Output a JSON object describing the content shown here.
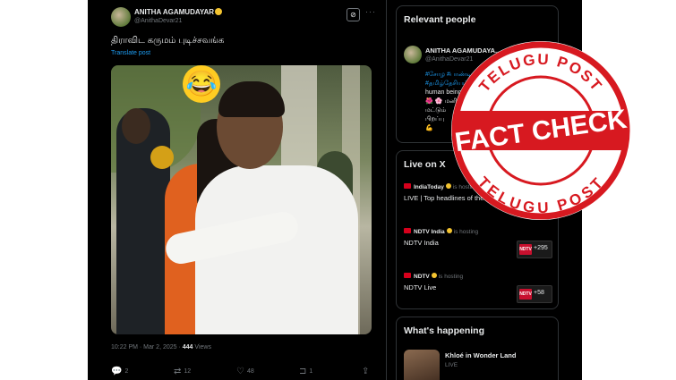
{
  "post": {
    "author_name": "ANITHA AGAMUDAYAR",
    "author_handle": "@AnithaDevar21",
    "text": "திராவிட கருமம் புடிச்சவங்க",
    "translate_label": "Translate post",
    "emoji": "😂",
    "timestamp": "10:22 PM · Mar 2, 2025 · ",
    "views_count": "444",
    "views_label": " Views",
    "actions": [
      {
        "icon": "reply-icon",
        "glyph": "💬",
        "count": "2"
      },
      {
        "icon": "repost-icon",
        "glyph": "⇄",
        "count": "12"
      },
      {
        "icon": "like-icon",
        "glyph": "♡",
        "count": "48"
      },
      {
        "icon": "bookmark-icon",
        "glyph": "⊐",
        "count": "1"
      },
      {
        "icon": "share-icon",
        "glyph": "⇪",
        "count": ""
      }
    ],
    "grok_glyph": "⊘",
    "more_glyph": "···"
  },
  "relevant_people": {
    "heading": "Relevant people",
    "name": "ANITHA AGAMUDAYA...",
    "handle": "@AnithaDevar21",
    "bio_lines": [
      "#சோழ #பாண்டிய",
      "#தமிழ்தேசியம்",
      "human being",
      "🌺 🌸 மனித",
      "மட்டும்",
      "பிறப்பு",
      "💪"
    ]
  },
  "live": {
    "heading": "Live on X",
    "items": [
      {
        "host": "IndiaToday",
        "status": "is hosting",
        "title": "LIVE | Top headlines of the hour",
        "count": ""
      },
      {
        "host": "NDTV India",
        "status": "is hosting",
        "title": "NDTV India",
        "count": "+295",
        "badge": "NDTV"
      },
      {
        "host": "NDTV",
        "status": "is hosting",
        "title": "NDTV Live",
        "count": "+58",
        "badge": "NDTV"
      }
    ]
  },
  "happening": {
    "heading": "What's happening",
    "title": "Khloé in Wonder Land",
    "subtitle": "LIVE"
  },
  "stamp": {
    "top_text": "TELUGU POST",
    "center_text": "FACT CHECK",
    "bottom_text": "TELUGU POST",
    "color": "#d71920"
  }
}
